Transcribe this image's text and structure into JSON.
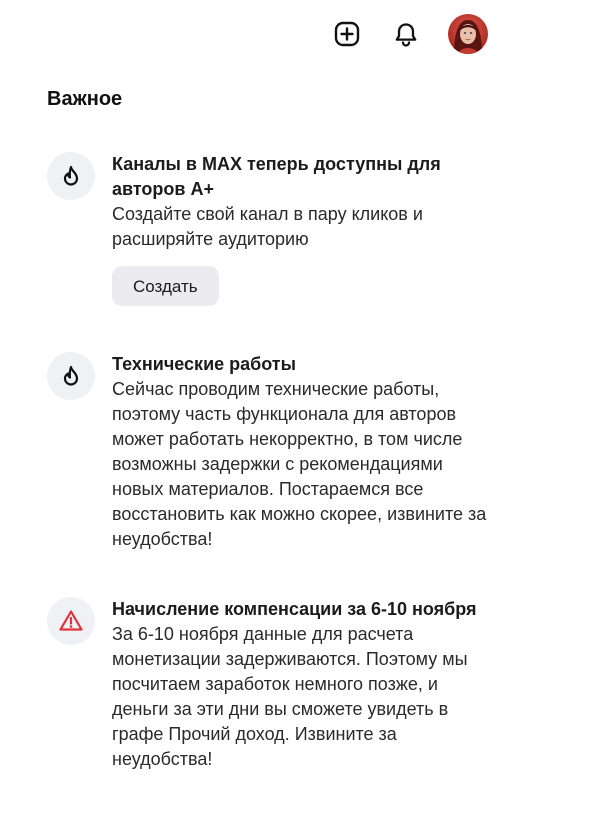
{
  "header": {
    "add_icon": "plus-square-icon",
    "bell_icon": "bell-icon",
    "avatar_icon": "user-avatar"
  },
  "section": {
    "title": "Важное"
  },
  "notices": [
    {
      "icon": "flame-icon",
      "title": "Каналы в MAX теперь доступны для авторов А+",
      "text": "Создайте свой канал в пару кликов и расширяйте аудиторию",
      "button_label": "Создать"
    },
    {
      "icon": "flame-icon",
      "title": "Технические работы",
      "text": "Сейчас проводим технические работы, поэтому часть функционала для авторов может работать некорректно, в том числе возможны задержки с рекомендациями новых материалов. Постараемся все восстановить как можно скорее, извините за неудобства!"
    },
    {
      "icon": "warning-triangle-icon",
      "title": "Начисление компенсации за 6-10 ноября",
      "text": "За 6-10 ноября данные для расчета монетизации задерживаются. Поэтому мы посчитаем заработок немного позже, и деньги за эти дни вы сможете увидеть в графе Прочий доход. Извините за неудобства!",
      "accent": "#e0333a"
    }
  ]
}
